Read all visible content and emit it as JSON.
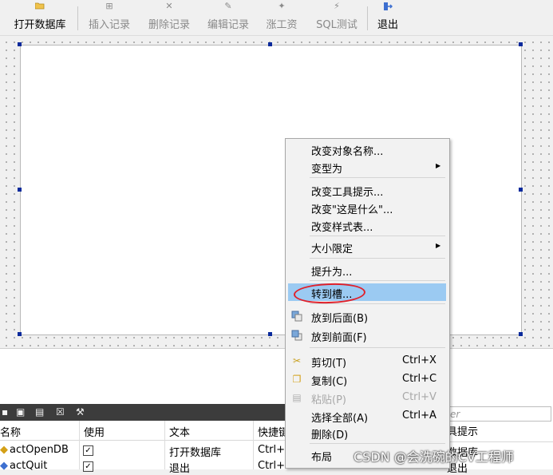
{
  "toolbar": {
    "items": [
      {
        "label": "打开数据库",
        "icon": "folder-open-icon",
        "enabled": true
      },
      {
        "label": "插入记录",
        "icon": "insert-record-icon",
        "enabled": false
      },
      {
        "label": "删除记录",
        "icon": "delete-icon",
        "enabled": false
      },
      {
        "label": "编辑记录",
        "icon": "edit-icon",
        "enabled": false
      },
      {
        "label": "涨工资",
        "icon": "up-arrow-icon",
        "enabled": false
      },
      {
        "label": "SQL测试",
        "icon": "sql-icon",
        "enabled": false
      },
      {
        "label": "退出",
        "icon": "exit-icon",
        "enabled": true
      }
    ]
  },
  "context_menu": {
    "items": [
      {
        "label": "改变对象名称...",
        "shortcut": "",
        "submenu": false,
        "enabled": true
      },
      {
        "label": "变型为",
        "shortcut": "",
        "submenu": true,
        "enabled": true
      },
      {
        "label": "改变工具提示...",
        "shortcut": "",
        "submenu": false,
        "enabled": true
      },
      {
        "label": "改变\"这是什么\"...",
        "shortcut": "",
        "submenu": false,
        "enabled": true
      },
      {
        "label": "改变样式表...",
        "shortcut": "",
        "submenu": false,
        "enabled": true
      },
      {
        "label": "大小限定",
        "shortcut": "",
        "submenu": true,
        "enabled": true
      },
      {
        "label": "提升为...",
        "shortcut": "",
        "submenu": false,
        "enabled": true
      },
      {
        "label": "转到槽...",
        "shortcut": "",
        "submenu": false,
        "enabled": true,
        "highlighted": true
      },
      {
        "label": "放到后面(B)",
        "shortcut": "",
        "submenu": false,
        "enabled": true
      },
      {
        "label": "放到前面(F)",
        "shortcut": "",
        "submenu": false,
        "enabled": true
      },
      {
        "label": "剪切(T)",
        "shortcut": "Ctrl+X",
        "submenu": false,
        "enabled": true
      },
      {
        "label": "复制(C)",
        "shortcut": "Ctrl+C",
        "submenu": false,
        "enabled": true
      },
      {
        "label": "粘贴(P)",
        "shortcut": "Ctrl+V",
        "submenu": false,
        "enabled": false
      },
      {
        "label": "选择全部(A)",
        "shortcut": "Ctrl+A",
        "submenu": false,
        "enabled": true
      },
      {
        "label": "删除(D)",
        "shortcut": "",
        "submenu": false,
        "enabled": true
      },
      {
        "label": "布局",
        "shortcut": "",
        "submenu": true,
        "enabled": true
      }
    ]
  },
  "action_editor": {
    "columns": [
      "名称",
      "使用",
      "文本",
      "快捷键"
    ],
    "rows": [
      {
        "name": "actOpenDB",
        "used": true,
        "text": "打开数据库",
        "shortcut": "Ctrl+"
      },
      {
        "name": "actQuit",
        "used": true,
        "text": "退出",
        "shortcut": "Ctrl+"
      }
    ]
  },
  "right_panel": {
    "filter_placeholder": "er",
    "header": "具提示",
    "rows": [
      "数据库",
      "退出"
    ]
  },
  "watermark": "CSDN @会洗碗的CV工程师",
  "colors": {
    "highlight": "#9bcaf2",
    "annotation_circle": "#e0212b",
    "handle": "#0a2a9c"
  }
}
